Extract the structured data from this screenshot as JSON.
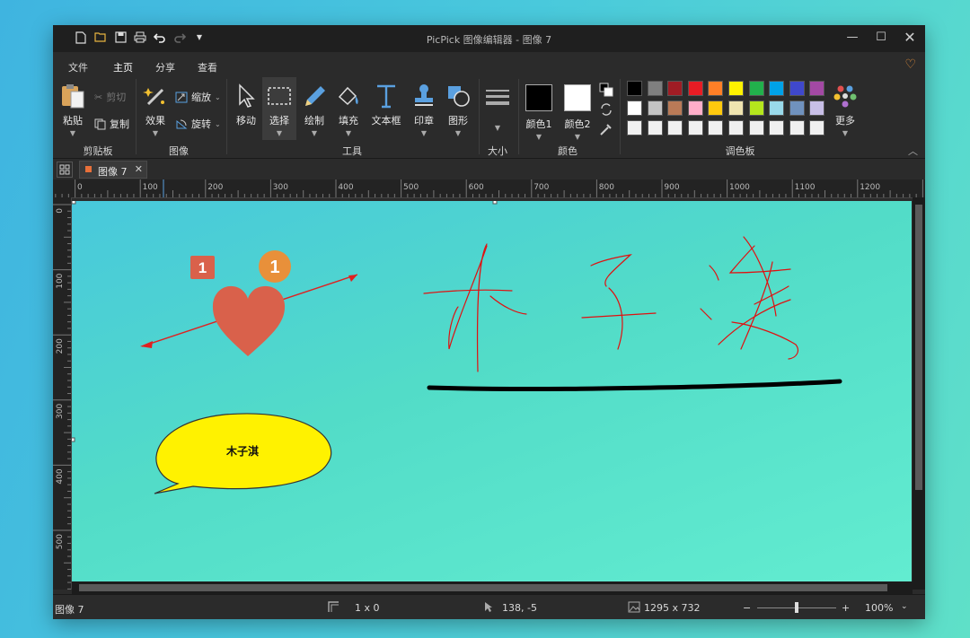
{
  "window": {
    "title": "PicPick 图像编辑器 - 图像 7"
  },
  "menu": {
    "tabs": [
      "文件",
      "主页",
      "分享",
      "查看"
    ],
    "active": "主页"
  },
  "ribbon": {
    "clipboard": {
      "paste": "粘贴",
      "cut": "剪切",
      "copy": "复制",
      "group": "剪贴板"
    },
    "image": {
      "effects": "效果",
      "resize": "缩放",
      "rotate": "旋转",
      "group": "图像"
    },
    "tools": {
      "move": "移动",
      "select": "选择",
      "draw": "绘制",
      "fill": "填充",
      "textbox": "文本框",
      "stamp": "印章",
      "shape": "图形",
      "group": "工具"
    },
    "size": {
      "group": "大小"
    },
    "colors": {
      "color1": "颜色1",
      "color2": "颜色2",
      "group": "颜色"
    },
    "palette": {
      "group": "调色板",
      "more": "更多",
      "row1": [
        "#000000",
        "#7f7f7f",
        "#a01c24",
        "#e81c24",
        "#ff7f27",
        "#fff200",
        "#22b14c",
        "#00a2e8",
        "#3f48cc",
        "#a349a4"
      ],
      "row2": [
        "#ffffff",
        "#c3c3c3",
        "#b97a57",
        "#ffaec9",
        "#ffc90e",
        "#efe4b0",
        "#b5e61d",
        "#99d9ea",
        "#7092be",
        "#c8bfe7"
      ],
      "row3": [
        "#f0f0f0",
        "#f0f0f0",
        "#f0f0f0",
        "#f0f0f0",
        "#f0f0f0",
        "#f0f0f0",
        "#f0f0f0",
        "#f0f0f0",
        "#f0f0f0",
        "#f0f0f0"
      ]
    }
  },
  "doc_tab": {
    "label": "图像 7"
  },
  "ruler": {
    "h_ticks": [
      "0",
      "100",
      "200",
      "300",
      "400",
      "500",
      "600",
      "700",
      "800",
      "900",
      "1000",
      "1100",
      "1200"
    ],
    "v_ticks": [
      "0",
      "100",
      "200",
      "300",
      "400",
      "500"
    ]
  },
  "canvas": {
    "badge_square": "1",
    "badge_circle": "1",
    "bubble_text": "木子淇",
    "colors": {
      "heart": "#d9614b",
      "badge_square": "#d9614b",
      "badge_circle": "#e8903a",
      "arrow": "#e02020",
      "bubble": "#fff200",
      "handwriting": "#e01010"
    }
  },
  "status": {
    "name": "图像 7",
    "selection": "1 x 0",
    "cursor": "138, -5",
    "dimensions": "1295 x 732",
    "zoom_minus": "−",
    "zoom_plus": "+",
    "zoom": "100%"
  }
}
